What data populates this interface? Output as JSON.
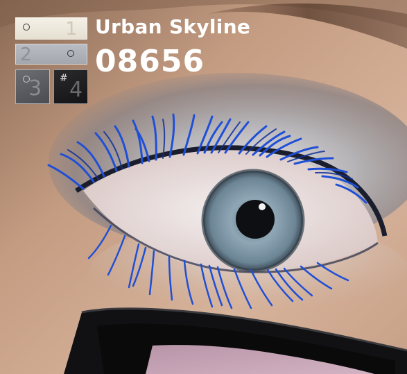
{
  "product": {
    "name": "Urban Skyline",
    "code": "08656"
  },
  "swatches": [
    {
      "number": "1",
      "color": "#ece7db"
    },
    {
      "number": "2",
      "color": "#aeb1b7"
    },
    {
      "number": "3",
      "color": "#5a5c61"
    },
    {
      "number": "4",
      "symbol": "#",
      "color": "#1f1f22"
    }
  ],
  "colors": {
    "skin": "#c9a48a",
    "eyeshadow": "#b8b6b8",
    "lash_blue": "#1f4fd6",
    "iris": "#7f97a8"
  }
}
